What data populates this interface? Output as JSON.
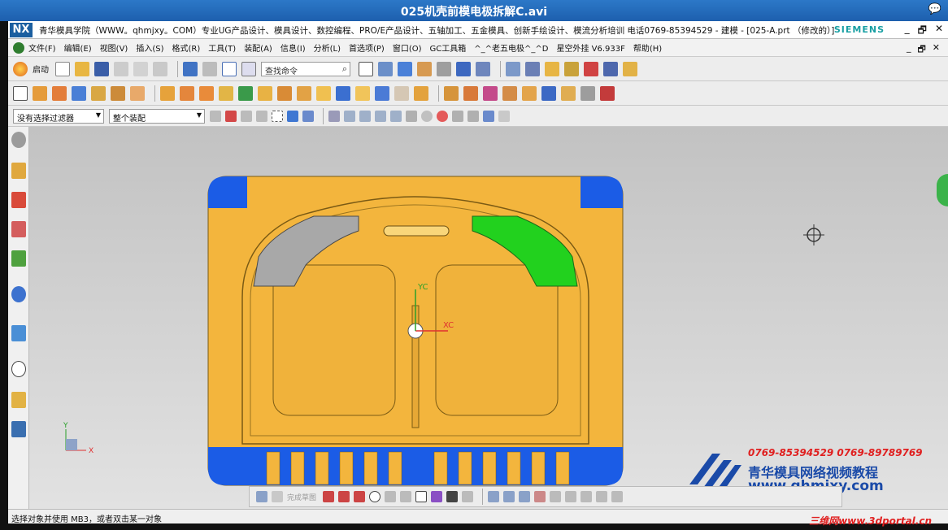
{
  "window": {
    "title": "025机壳前模电极拆解C.avi",
    "chat_icon": "chat-bubble-icon"
  },
  "appbar": {
    "logo": "NX",
    "title": "青华模具学院（WWW。qhmjxy。COM）专业UG产品设计、模具设计、数控编程、PRO/E产品设计、五轴加工、五金模具、创新手绘设计、模流分析培训  电话0769-85394529 - 建模 - [025-A.prt （修改的）]",
    "brand": "SIEMENS",
    "controls": [
      "_",
      "🗗",
      "✕"
    ]
  },
  "menubar": {
    "items": [
      "文件(F)",
      "编辑(E)",
      "视图(V)",
      "插入(S)",
      "格式(R)",
      "工具(T)",
      "装配(A)",
      "信息(I)",
      "分析(L)",
      "首选项(P)",
      "窗口(O)",
      "GC工具箱",
      "^_^老五电极^_^D",
      "星空外挂 V6.933F",
      "帮助(H)"
    ],
    "controls": [
      "_",
      "🗗",
      "✕"
    ]
  },
  "toolbar1": {
    "start_label": "启动",
    "search_placeholder": "查找命令"
  },
  "toolbar3": {
    "filter": "没有选择过滤器",
    "scope": "整个装配"
  },
  "snapbar": {
    "label": "完成草图"
  },
  "viewport": {
    "axis_labels": {
      "xc": "XC",
      "yc": "YC",
      "x": "X",
      "y": "Y"
    }
  },
  "watermark": {
    "phones": "0769-85394529  0769-89789769",
    "name": "青华模具网络视频教程",
    "url": "www.qhmjxy.com"
  },
  "portal": "三维网www.3dportal.cn",
  "status": {
    "text": "选择对象并使用 MB3，或者双击某一对象"
  },
  "colors": {
    "mold_yellow": "#f3b53d",
    "mold_blue": "#1b5ce6",
    "electrode_green": "#22d11e",
    "electrode_gray": "#a8a8a8",
    "title_blue": "#1d5fae"
  }
}
